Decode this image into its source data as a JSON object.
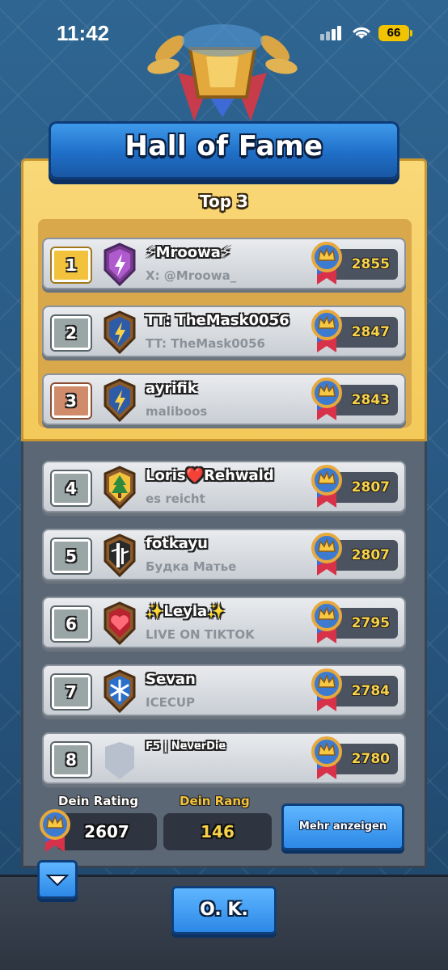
{
  "status_bar": {
    "time": "11:42",
    "battery": "66"
  },
  "title": "Hall of Fame",
  "top3_label": "Top 3",
  "players": [
    {
      "rank": "1",
      "name": "⚡Mroowa⚡",
      "clan": "X: @Mroowa_",
      "trophies": "2855",
      "badge": "lightning-clan-badge-icon"
    },
    {
      "rank": "2",
      "name": "TT: TheMask0056",
      "clan": "TT: TheMask0056",
      "trophies": "2847",
      "badge": "lightning-clan-badge-icon"
    },
    {
      "rank": "3",
      "name": "ayrifik",
      "clan": "maliboos",
      "trophies": "2843",
      "badge": "lightning-clan-badge-icon"
    },
    {
      "rank": "4",
      "name": "Loris❤️Rehwald",
      "clan": "es reicht",
      "trophies": "2807",
      "badge": "tree-clan-badge-icon"
    },
    {
      "rank": "5",
      "name": "fotkayu",
      "clan": "Будка Матье",
      "trophies": "2807",
      "badge": "bamboo-clan-badge-icon"
    },
    {
      "rank": "6",
      "name": "✨Leyla✨",
      "clan": "LIVE ON TIKTOK",
      "trophies": "2795",
      "badge": "heart-clan-badge-icon"
    },
    {
      "rank": "7",
      "name": "Sevan",
      "clan": "ICECUP",
      "trophies": "2784",
      "badge": "snowflake-clan-badge-icon"
    },
    {
      "rank": "8",
      "name": "F5 | NeverDie",
      "clan": "",
      "trophies": "2780",
      "badge": "empty-clan-badge-icon"
    }
  ],
  "footer": {
    "rating_label": "Dein Rating",
    "rating_value": "2607",
    "rank_label": "Dein Rang",
    "rank_value": "146",
    "more_button": "Mehr anzeigen",
    "ok_button": "O. K."
  },
  "colors": {
    "gold_panel": "#f3c95a",
    "grey_panel": "#5c6776",
    "banner_blue": "#1f6fc8",
    "trophy_text": "#f7d14a",
    "rank_label_gold": "#f2c23c"
  }
}
